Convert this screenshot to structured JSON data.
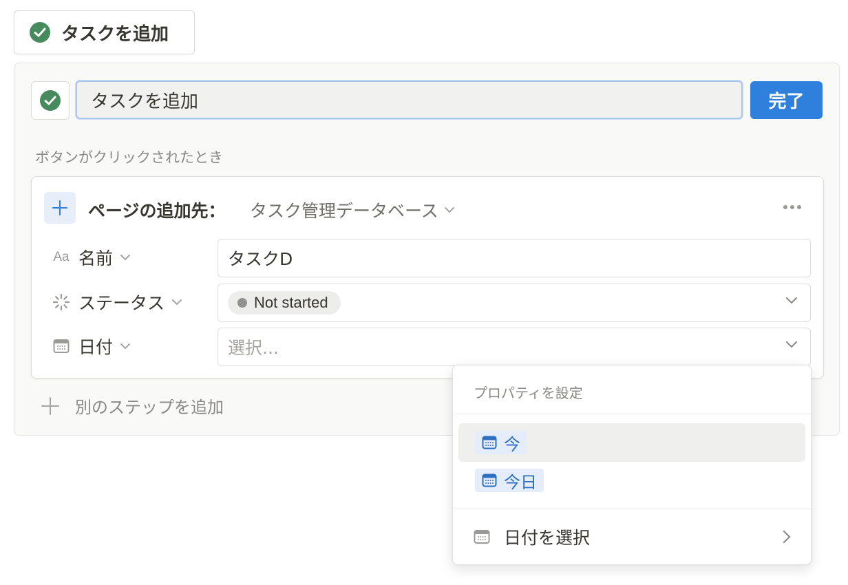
{
  "trigger_button": {
    "label": "タスクを追加",
    "icon": "check-circle-icon"
  },
  "editor": {
    "title_value": "タスクを追加",
    "done_label": "完了",
    "section_label": "ボタンがクリックされたとき"
  },
  "step": {
    "title": "ページの追加先：",
    "database": "タスク管理データベース",
    "properties": [
      {
        "name": "名前",
        "icon": "Aa",
        "value": "タスクD"
      },
      {
        "name": "ステータス",
        "icon": "status-icon",
        "value": "Not started"
      },
      {
        "name": "日付",
        "icon": "calendar-icon",
        "placeholder": "選択..."
      }
    ]
  },
  "add_step_label": "別のステップを追加",
  "dropdown": {
    "header": "プロパティを設定",
    "options": [
      {
        "label": "今",
        "icon": "calendar-icon"
      },
      {
        "label": "今日",
        "icon": "calendar-icon"
      }
    ],
    "pick_date_label": "日付を選択"
  },
  "colors": {
    "accent": "#2f80dd",
    "check_green": "#468a5d",
    "chip_bg": "#e4edf9",
    "chip_text": "#2f6fc2"
  }
}
